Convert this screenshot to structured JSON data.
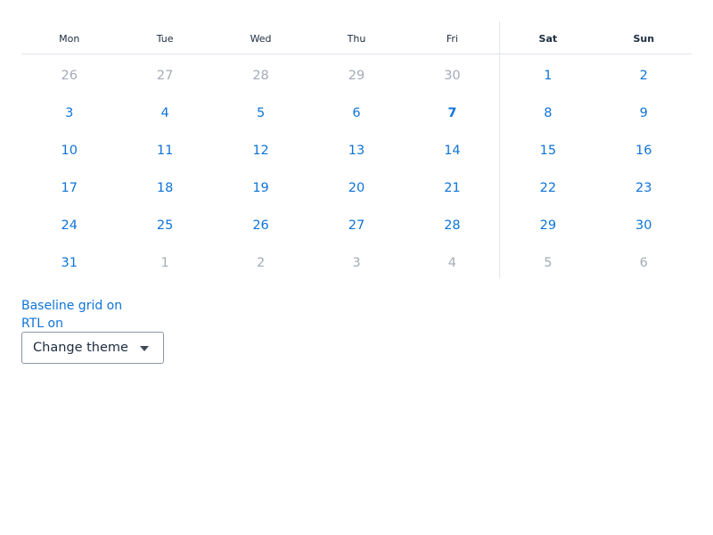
{
  "calendar": {
    "weekdays": [
      {
        "label": "Mon",
        "weekend": false
      },
      {
        "label": "Tue",
        "weekend": false
      },
      {
        "label": "Wed",
        "weekend": false
      },
      {
        "label": "Thu",
        "weekend": false
      },
      {
        "label": "Fri",
        "weekend": false
      },
      {
        "label": "Sat",
        "weekend": true
      },
      {
        "label": "Sun",
        "weekend": true
      }
    ],
    "days": [
      {
        "label": "26",
        "in_month": false
      },
      {
        "label": "27",
        "in_month": false
      },
      {
        "label": "28",
        "in_month": false
      },
      {
        "label": "29",
        "in_month": false
      },
      {
        "label": "30",
        "in_month": false
      },
      {
        "label": "1",
        "in_month": true
      },
      {
        "label": "2",
        "in_month": true
      },
      {
        "label": "3",
        "in_month": true
      },
      {
        "label": "4",
        "in_month": true
      },
      {
        "label": "5",
        "in_month": true
      },
      {
        "label": "6",
        "in_month": true
      },
      {
        "label": "7",
        "in_month": true,
        "today": true
      },
      {
        "label": "8",
        "in_month": true
      },
      {
        "label": "9",
        "in_month": true
      },
      {
        "label": "10",
        "in_month": true
      },
      {
        "label": "11",
        "in_month": true
      },
      {
        "label": "12",
        "in_month": true
      },
      {
        "label": "13",
        "in_month": true
      },
      {
        "label": "14",
        "in_month": true
      },
      {
        "label": "15",
        "in_month": true
      },
      {
        "label": "16",
        "in_month": true
      },
      {
        "label": "17",
        "in_month": true
      },
      {
        "label": "18",
        "in_month": true
      },
      {
        "label": "19",
        "in_month": true
      },
      {
        "label": "20",
        "in_month": true
      },
      {
        "label": "21",
        "in_month": true
      },
      {
        "label": "22",
        "in_month": true
      },
      {
        "label": "23",
        "in_month": true
      },
      {
        "label": "24",
        "in_month": true
      },
      {
        "label": "25",
        "in_month": true
      },
      {
        "label": "26",
        "in_month": true
      },
      {
        "label": "27",
        "in_month": true
      },
      {
        "label": "28",
        "in_month": true
      },
      {
        "label": "29",
        "in_month": true
      },
      {
        "label": "30",
        "in_month": true
      },
      {
        "label": "31",
        "in_month": true
      },
      {
        "label": "1",
        "in_month": false
      },
      {
        "label": "2",
        "in_month": false
      },
      {
        "label": "3",
        "in_month": false
      },
      {
        "label": "4",
        "in_month": false
      },
      {
        "label": "5",
        "in_month": false
      },
      {
        "label": "6",
        "in_month": false
      }
    ]
  },
  "controls": {
    "baseline_grid_label": "Baseline grid on",
    "rtl_label": "RTL on",
    "theme_button_label": "Change theme"
  },
  "colors": {
    "accent": "#0f74d8",
    "muted": "#a4abb6",
    "text": "#1d2c3f"
  }
}
